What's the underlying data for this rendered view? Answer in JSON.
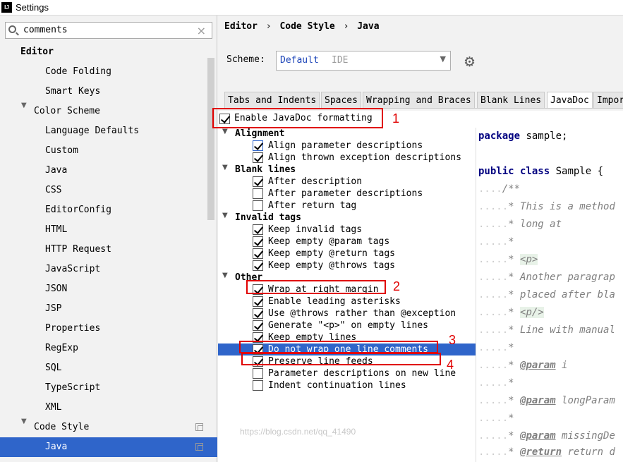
{
  "window": {
    "title": "Settings",
    "app_icon": "IJ"
  },
  "search": {
    "value": "comments",
    "clear": "×"
  },
  "tree": [
    {
      "label": "Editor",
      "level": 0,
      "bold": true
    },
    {
      "label": "Code Folding",
      "level": 2
    },
    {
      "label": "Smart Keys",
      "level": 2
    },
    {
      "label": "Color Scheme",
      "level": 1,
      "expanded": true
    },
    {
      "label": "Language Defaults",
      "level": 2
    },
    {
      "label": "Custom",
      "level": 2
    },
    {
      "label": "Java",
      "level": 2
    },
    {
      "label": "CSS",
      "level": 2
    },
    {
      "label": "EditorConfig",
      "level": 2
    },
    {
      "label": "HTML",
      "level": 2
    },
    {
      "label": "HTTP Request",
      "level": 2
    },
    {
      "label": "JavaScript",
      "level": 2
    },
    {
      "label": "JSON",
      "level": 2
    },
    {
      "label": "JSP",
      "level": 2
    },
    {
      "label": "Properties",
      "level": 2
    },
    {
      "label": "RegExp",
      "level": 2
    },
    {
      "label": "SQL",
      "level": 2
    },
    {
      "label": "TypeScript",
      "level": 2
    },
    {
      "label": "XML",
      "level": 2
    },
    {
      "label": "Code Style",
      "level": 1,
      "expanded": true,
      "copy": true
    },
    {
      "label": "Java",
      "level": 2,
      "selected": true,
      "copy": true
    }
  ],
  "breadcrumb": [
    "Editor",
    "Code Style",
    "Java"
  ],
  "breadcrumb_sep": "›",
  "scheme": {
    "label": "Scheme:",
    "value": "Default",
    "kind": "IDE"
  },
  "tabs": [
    "Tabs and Indents",
    "Spaces",
    "Wrapping and Braces",
    "Blank Lines",
    "JavaDoc",
    "Impor"
  ],
  "active_tab": "JavaDoc",
  "enable": {
    "label": "Enable JavaDoc formatting",
    "checked": true
  },
  "groups": [
    {
      "title": "Alignment",
      "items": [
        {
          "label": "Align parameter descriptions",
          "checked": true,
          "blue": true
        },
        {
          "label": "Align thrown exception descriptions",
          "checked": true
        }
      ]
    },
    {
      "title": "Blank lines",
      "items": [
        {
          "label": "After description",
          "checked": true
        },
        {
          "label": "After parameter descriptions",
          "checked": false
        },
        {
          "label": "After return tag",
          "checked": false
        }
      ]
    },
    {
      "title": "Invalid tags",
      "items": [
        {
          "label": "Keep invalid tags",
          "checked": true
        },
        {
          "label": "Keep empty @param tags",
          "checked": true
        },
        {
          "label": "Keep empty @return tags",
          "checked": true
        },
        {
          "label": "Keep empty @throws tags",
          "checked": true
        }
      ]
    },
    {
      "title": "Other",
      "items": [
        {
          "label": "Wrap at right margin",
          "checked": true
        },
        {
          "label": "Enable leading asterisks",
          "checked": true
        },
        {
          "label": "Use @throws rather than @exception",
          "checked": true
        },
        {
          "label": "Generate \"<p>\" on empty lines",
          "checked": true
        },
        {
          "label": "Keep empty lines",
          "checked": true
        },
        {
          "label": "Do not wrap one line comments",
          "checked": true,
          "selected": true
        },
        {
          "label": "Preserve line feeds",
          "checked": true
        },
        {
          "label": "Parameter descriptions on new line",
          "checked": false
        },
        {
          "label": "Indent continuation lines",
          "checked": false
        }
      ]
    }
  ],
  "code": {
    "l1_kw": "package",
    "l1_rest": " sample;",
    "l2_kw": "public class",
    "l2_rest": " Sample {",
    "l3": "/**",
    "l4": "* This is a method",
    "l5": "* long at",
    "l6": "*",
    "l7_star": "* ",
    "l7_tag": "<p>",
    "l8": "* Another paragrap",
    "l9": "* placed after bla",
    "l10_star": "* ",
    "l10_tag": "<p/>",
    "l11": "* Line with manual",
    "l12": "*",
    "l13_star": "* ",
    "l13_tag": "@param",
    "l13_rest": " i",
    "l14": "*",
    "l15_star": "* ",
    "l15_tag": "@param",
    "l15_rest": " longParam",
    "l16": "*",
    "l17_star": "* ",
    "l17_tag": "@param",
    "l17_rest": " missingDe",
    "l18_star": "* ",
    "l18_tag": "@return",
    "l18_rest": " return d"
  },
  "annotations": [
    "1",
    "2",
    "3",
    "4"
  ],
  "watermark": "https://blog.csdn.net/qq_41490"
}
